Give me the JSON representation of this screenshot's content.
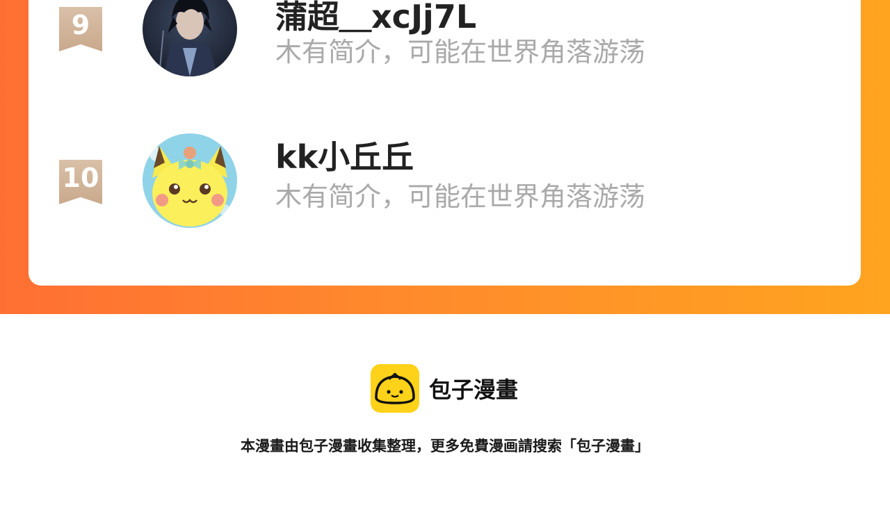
{
  "colors": {
    "band_start": "#ff6f33",
    "band_end": "#ffa41f",
    "ribbon": "#d1b399",
    "username": "#222222",
    "bio": "#a9a9a9",
    "logo_yellow": "#ffd21a"
  },
  "leaderboard": {
    "rows": [
      {
        "rank": "9",
        "username": "蒲超＿xcJj7L",
        "bio": "木有简介，可能在世界角落游荡",
        "avatar_icon": "anime-boy-avatar"
      },
      {
        "rank": "10",
        "username": "kk小丘丘",
        "bio": "木有简介，可能在世界角落游荡",
        "avatar_icon": "pikachu-avatar"
      }
    ]
  },
  "footer": {
    "brand_name": "包子漫畫",
    "logo_icon": "bun-logo-icon",
    "note": "本漫畫由包子漫畫收集整理，更多免費漫画請搜索「包子漫畫」"
  }
}
